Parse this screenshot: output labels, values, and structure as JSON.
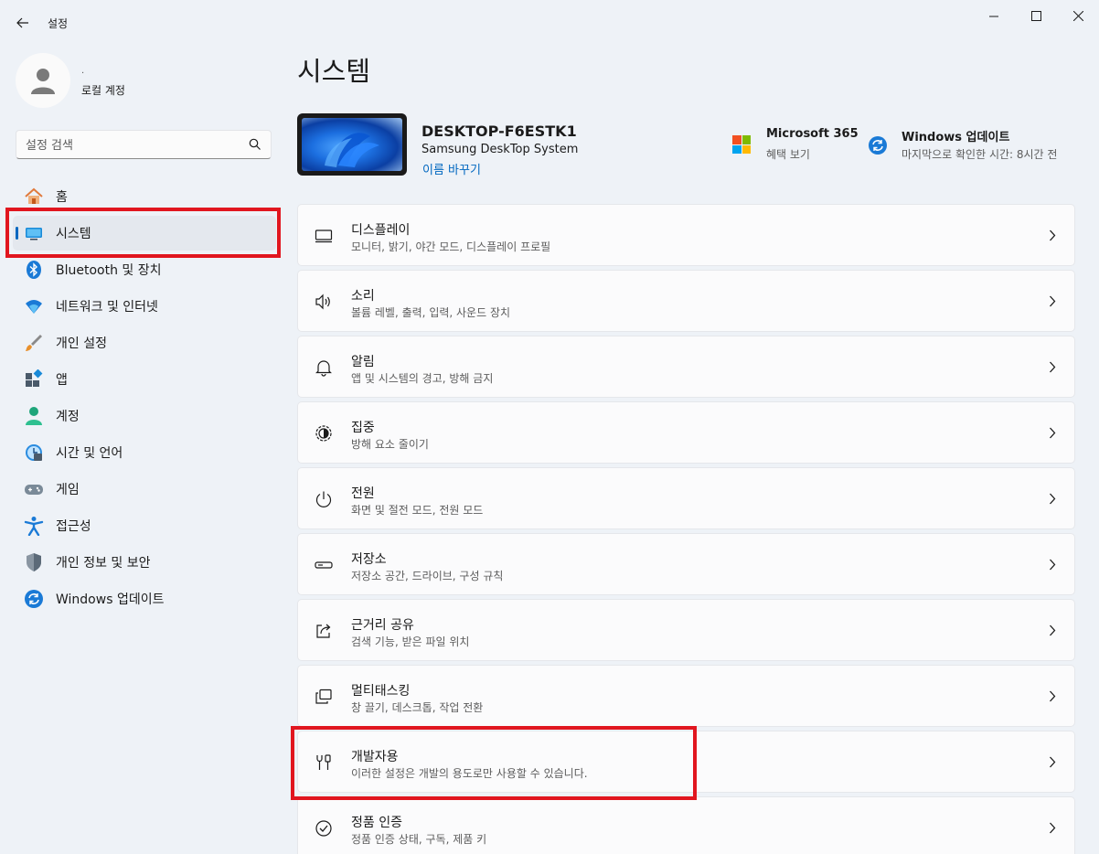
{
  "window": {
    "title": "설정"
  },
  "profile": {
    "name": "로컬 계정",
    "sub": "."
  },
  "search": {
    "placeholder": "설정 검색"
  },
  "sidebar": {
    "items": [
      {
        "label": "홈",
        "icon": "home-icon",
        "active": false
      },
      {
        "label": "시스템",
        "icon": "system-icon",
        "active": true
      },
      {
        "label": "Bluetooth 및 장치",
        "icon": "bluetooth-icon",
        "active": false
      },
      {
        "label": "네트워크 및 인터넷",
        "icon": "wifi-icon",
        "active": false
      },
      {
        "label": "개인 설정",
        "icon": "brush-icon",
        "active": false
      },
      {
        "label": "앱",
        "icon": "apps-icon",
        "active": false
      },
      {
        "label": "계정",
        "icon": "account-icon",
        "active": false
      },
      {
        "label": "시간 및 언어",
        "icon": "time-language-icon",
        "active": false
      },
      {
        "label": "게임",
        "icon": "gamepad-icon",
        "active": false
      },
      {
        "label": "접근성",
        "icon": "accessibility-icon",
        "active": false
      },
      {
        "label": "개인 정보 및 보안",
        "icon": "shield-icon",
        "active": false
      },
      {
        "label": "Windows 업데이트",
        "icon": "windows-update-icon",
        "active": false
      }
    ]
  },
  "main": {
    "title": "시스템",
    "device": {
      "name": "DESKTOP-F6ESTK1",
      "model": "Samsung DeskTop System",
      "rename": "이름 바꾸기"
    },
    "m365": {
      "title": "Microsoft 365",
      "sub": "혜택 보기"
    },
    "windows_update": {
      "title": "Windows 업데이트",
      "sub": "마지막으로 확인한 시간: 8시간 전"
    },
    "settings": [
      {
        "title": "디스플레이",
        "sub": "모니터, 밝기, 야간 모드, 디스플레이 프로필",
        "icon": "display-icon"
      },
      {
        "title": "소리",
        "sub": "볼륨 레벨, 출력, 입력, 사운드 장치",
        "icon": "speaker-icon"
      },
      {
        "title": "알림",
        "sub": "앱 및 시스템의 경고, 방해 금지",
        "icon": "bell-icon"
      },
      {
        "title": "집중",
        "sub": "방해 요소 줄이기",
        "icon": "focus-icon"
      },
      {
        "title": "전원",
        "sub": "화면 및 절전 모드, 전원 모드",
        "icon": "power-icon"
      },
      {
        "title": "저장소",
        "sub": "저장소 공간, 드라이브, 구성 규칙",
        "icon": "storage-icon"
      },
      {
        "title": "근거리 공유",
        "sub": "검색 기능, 받은 파일 위치",
        "icon": "share-icon"
      },
      {
        "title": "멀티태스킹",
        "sub": "창 끌기, 데스크톱, 작업 전환",
        "icon": "multitasking-icon"
      },
      {
        "title": "개발자용",
        "sub": "이러한 설정은 개발의 용도로만 사용할 수 있습니다.",
        "icon": "developer-tools-icon"
      },
      {
        "title": "정품 인증",
        "sub": "정품 인증 상태, 구독, 제품 키",
        "icon": "activation-icon"
      }
    ]
  },
  "colors": {
    "accent": "#0067c0",
    "highlight": "#e1161f",
    "background": "#eef2f7"
  }
}
